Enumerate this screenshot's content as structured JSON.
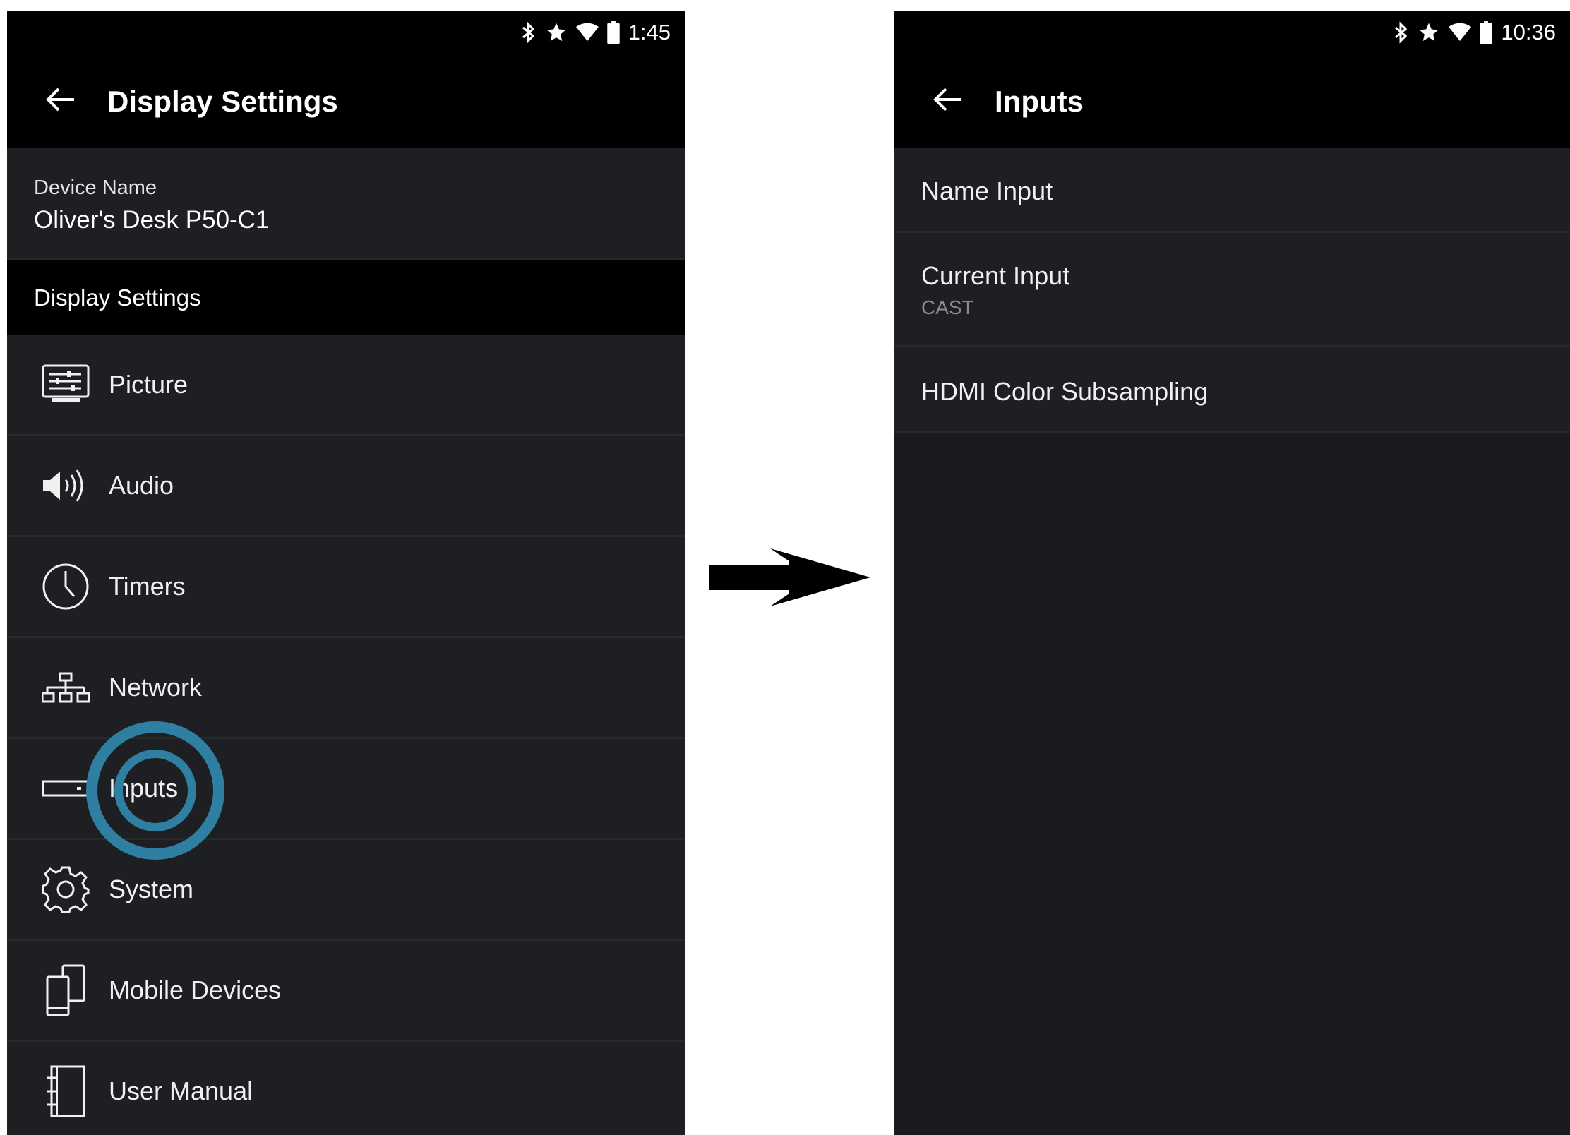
{
  "left_screen": {
    "status_bar": {
      "time": "1:45",
      "icons": [
        "bluetooth-icon",
        "star-icon",
        "wifi-icon",
        "battery-icon"
      ]
    },
    "header": {
      "title": "Display Settings",
      "back_icon": "back-arrow-icon"
    },
    "device": {
      "label": "Device Name",
      "value": "Oliver's Desk P50-C1"
    },
    "section_title": "Display Settings",
    "menu": [
      {
        "label": "Picture",
        "icon": "picture-icon"
      },
      {
        "label": "Audio",
        "icon": "audio-icon"
      },
      {
        "label": "Timers",
        "icon": "clock-icon"
      },
      {
        "label": "Network",
        "icon": "network-icon"
      },
      {
        "label": "Inputs",
        "icon": "inputs-icon",
        "highlighted": true
      },
      {
        "label": "System",
        "icon": "gear-icon"
      },
      {
        "label": "Mobile Devices",
        "icon": "mobile-devices-icon"
      },
      {
        "label": "User Manual",
        "icon": "manual-icon"
      }
    ]
  },
  "navigation_arrow_icon": "right-arrow-icon",
  "right_screen": {
    "status_bar": {
      "time": "10:36",
      "icons": [
        "bluetooth-icon",
        "star-icon",
        "wifi-icon",
        "battery-icon"
      ]
    },
    "header": {
      "title": "Inputs",
      "back_icon": "back-arrow-icon"
    },
    "items": [
      {
        "label": "Name Input"
      },
      {
        "label": "Current Input",
        "value": "CAST"
      },
      {
        "label": "HDMI Color Subsampling"
      }
    ]
  },
  "colors": {
    "phone_background": "#1a1b1e",
    "bar_background": "#000000",
    "text_primary": "#ffffff",
    "text_secondary": "#8a8c90",
    "tap_highlight": "#2e7fa1"
  }
}
